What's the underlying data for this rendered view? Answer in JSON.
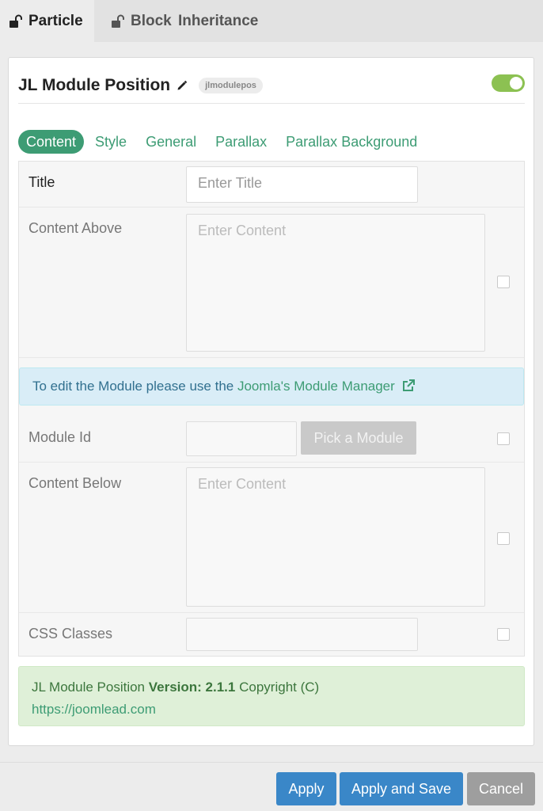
{
  "top_tabs": [
    {
      "label": "Particle",
      "icon": "unlock-icon",
      "active": true
    },
    {
      "label": "Block",
      "icon": "unlock-icon",
      "active": false
    },
    {
      "label": "Inheritance",
      "icon": "",
      "active": false
    }
  ],
  "particle": {
    "title": "JL Module Position",
    "badge": "jlmodulepos",
    "enabled": true
  },
  "sub_tabs": [
    "Content",
    "Style",
    "General",
    "Parallax",
    "Parallax Background"
  ],
  "form": {
    "title_label": "Title",
    "title_placeholder": "Enter Title",
    "content_above_label": "Content Above",
    "content_above_placeholder": "Enter Content",
    "info_text": "To edit the Module please use the ",
    "info_link": "Joomla's Module Manager",
    "module_id_label": "Module Id",
    "pick_module_label": "Pick a Module",
    "content_below_label": "Content Below",
    "content_below_placeholder": "Enter Content",
    "css_classes_label": "CSS Classes"
  },
  "notice": {
    "name": "JL Module Position",
    "version_label": "Version: 2.1.1",
    "copyright": "Copyright (C)",
    "url": "https://joomlead.com"
  },
  "buttons": {
    "apply": "Apply",
    "apply_and_save": "Apply and Save",
    "cancel": "Cancel"
  },
  "colors": {
    "accent_green": "#3d9c74",
    "primary_blue": "#3a87c8",
    "toggle_on": "#8cc152"
  }
}
